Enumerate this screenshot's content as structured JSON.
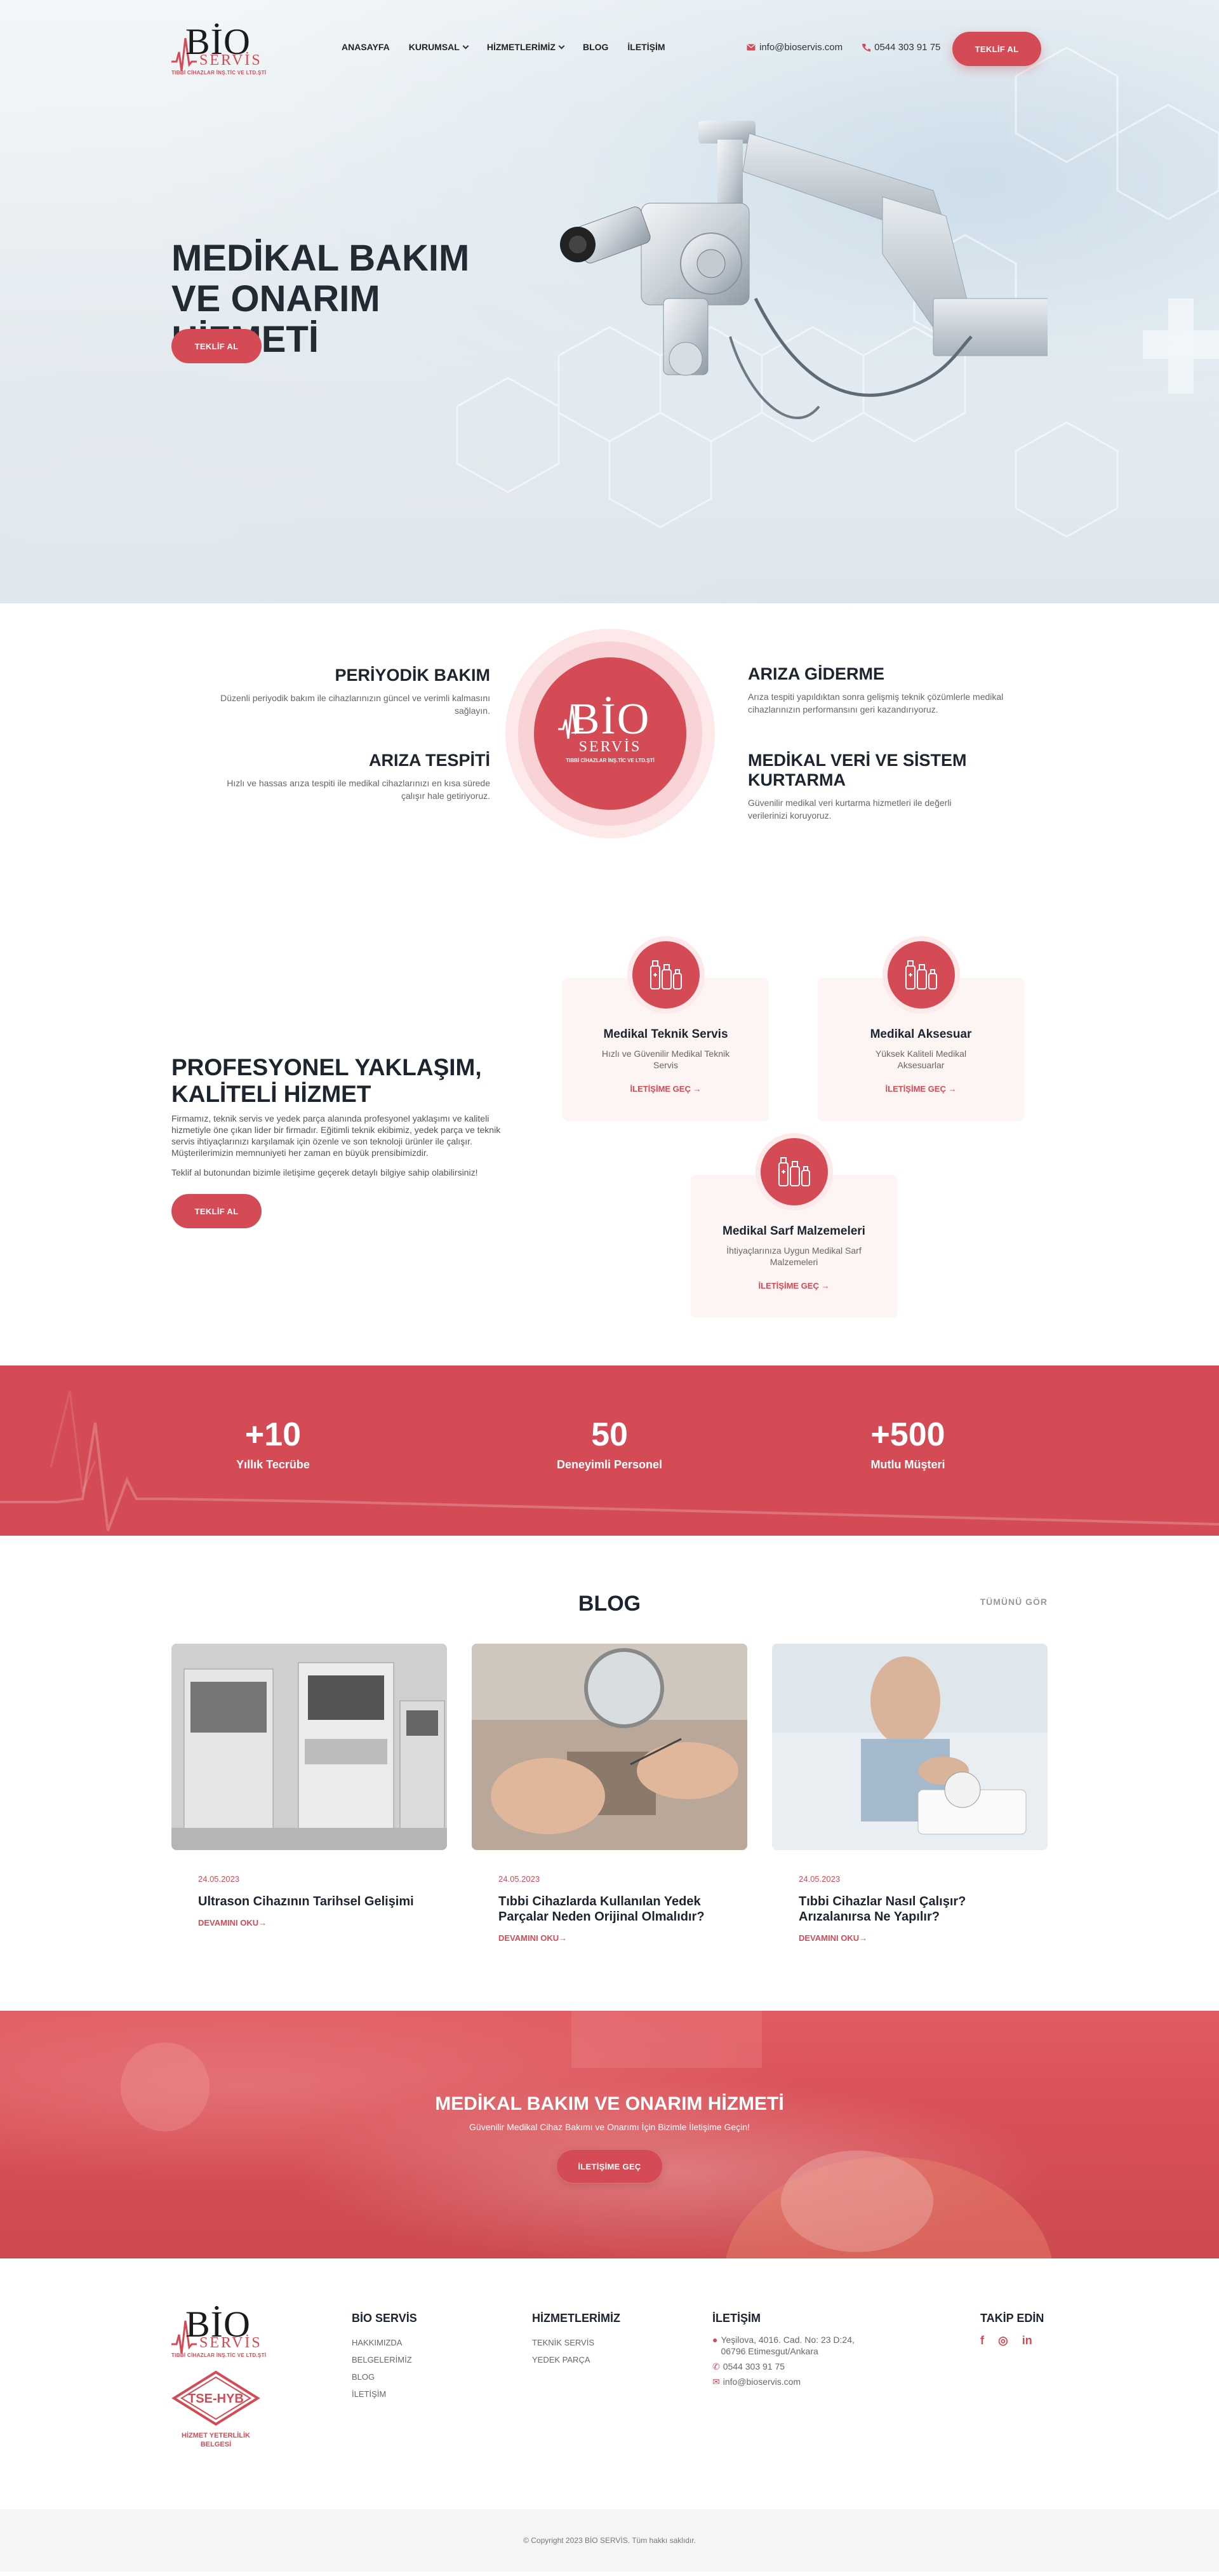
{
  "header": {
    "logo": {
      "main": "BİO",
      "sub": "SERVİS",
      "tagline": "TIBBİ CİHAZLAR İNŞ.TİC VE LTD.ŞTİ"
    },
    "nav": [
      {
        "label": "ANASAYFA",
        "dropdown": false
      },
      {
        "label": "KURUMSAL",
        "dropdown": true
      },
      {
        "label": "HİZMETLERİMİZ",
        "dropdown": true
      },
      {
        "label": "BLOG",
        "dropdown": false
      },
      {
        "label": "İLETİŞİM",
        "dropdown": false
      }
    ],
    "email": "info@bioservis.com",
    "phone": "0544 303 91 75",
    "cta_label": "TEKLİF AL"
  },
  "hero": {
    "title": "MEDİKAL BAKIM VE ONARIM HİZMETİ",
    "button": "TEKLİF AL"
  },
  "services": {
    "left": [
      {
        "title": "PERİYODİK BAKIM",
        "text": "Düzenli periyodik bakım ile cihazlarınızın güncel ve verimli kalmasını sağlayın."
      },
      {
        "title": "ARIZA TESPİTİ",
        "text": "Hızlı ve hassas arıza tespiti ile medikal cihazlarınızı en kısa sürede çalışır hale getiriyoruz."
      }
    ],
    "right": [
      {
        "title": "ARIZA GİDERME",
        "text": "Arıza tespiti yapıldıktan sonra gelişmiş teknik çözümlerle medikal cihazlarınızın performansını geri kazandırıyoruz."
      },
      {
        "title": "MEDİKAL VERİ VE SİSTEM KURTARMA",
        "text": "Güvenilir medikal veri kurtarma hizmetleri ile değerli verilerinizi koruyoruz."
      }
    ],
    "center_logo": {
      "main": "BİO",
      "sub": "SERVİS",
      "tagline": "TIBBİ CİHAZLAR İNŞ.TİC VE LTD.ŞTİ"
    }
  },
  "approach": {
    "title": "PROFESYONEL YAKLAŞIM, KALİTELİ HİZMET",
    "paragraph": "Firmamız, teknik servis ve yedek parça alanında profesyonel yaklaşımı ve kaliteli hizmetiyle öne çıkan lider bir firmadır. Eğitimli teknik ekibimiz, yedek parça ve teknik servis ihtiyaçlarınızı karşılamak için özenle ve son teknoloji ürünler ile çalışır. Müşterilerimizin memnuniyeti her zaman en büyük prensibimizdir.",
    "paragraph2": "Teklif al butonundan bizimle iletişime geçerek detaylı bilgiye sahip olabilirsiniz!",
    "button": "TEKLİF AL",
    "cards": [
      {
        "title": "Medikal Teknik Servis",
        "text": "Hızlı ve Güvenilir Medikal Teknik Servis",
        "link": "İLETİŞİME GEÇ →",
        "icon": "medical-bottles-icon"
      },
      {
        "title": "Medikal Aksesuar",
        "text": "Yüksek Kaliteli Medikal Aksesuarlar",
        "link": "İLETİŞİME GEÇ →",
        "icon": "medical-bottles-icon"
      },
      {
        "title": "Medikal Sarf Malzemeleri",
        "text": "İhtiyaçlarınıza Uygun Medikal Sarf Malzemeleri",
        "link": "İLETİŞİME GEÇ →",
        "icon": "medical-bottles-icon"
      }
    ]
  },
  "stats": [
    {
      "value": "+10",
      "label": "Yıllık Tecrübe"
    },
    {
      "value": "50",
      "label": "Deneyimli Personel"
    },
    {
      "value": "+500",
      "label": "Mutlu Müşteri"
    }
  ],
  "blog": {
    "heading": "BLOG",
    "see_all": "TÜMÜNÜ GÖR",
    "posts": [
      {
        "date": "24.05.2023",
        "title": "Ultrason Cihazının Tarihsel Gelişimi",
        "more": "DEVAMINI OKU→"
      },
      {
        "date": "24.05.2023",
        "title": "Tıbbi Cihazlarda Kullanılan Yedek Parçalar Neden Orijinal Olmalıdır?",
        "more": "DEVAMINI OKU→"
      },
      {
        "date": "24.05.2023",
        "title": "Tıbbi Cihazlar Nasıl Çalışır? Arızalanırsa Ne Yapılır?",
        "more": "DEVAMINI OKU→"
      }
    ]
  },
  "cta": {
    "title": "MEDİKAL BAKIM VE ONARIM HİZMETİ",
    "subtitle": "Güvenilir Medikal Cihaz Bakımı ve Onarımı İçin Bizimle İletişime Geçin!",
    "button": "İLETİŞİME GEÇ"
  },
  "footer": {
    "cert": {
      "badge": "TSE-HYB",
      "label": "HİZMET YETERLİLİK BELGESİ"
    },
    "col1": {
      "title": "BİO SERVİS",
      "links": [
        "HAKKIMIZDA",
        "BELGELERİMİZ",
        "BLOG",
        "İLETİŞİM"
      ]
    },
    "col2": {
      "title": "HİZMETLERİMİZ",
      "links": [
        "TEKNİK SERVİS",
        "YEDEK PARÇA"
      ]
    },
    "col3": {
      "title": "İLETİŞİM",
      "address": "Yeşilova, 4016. Cad. No: 23 D:24, 06796 Etimesgut/Ankara",
      "phone": "0544 303 91 75",
      "email": "info@bioservis.com"
    },
    "col4": {
      "title": "TAKİP EDİN",
      "social": [
        "f",
        "◎",
        "in"
      ]
    },
    "copyright": "© Copyright 2023 BİO SERVİS. Tüm hakkı saklıdır."
  },
  "colors": {
    "accent": "#d44b55",
    "dark": "#1c2430",
    "pink_light": "#fde8ea"
  }
}
